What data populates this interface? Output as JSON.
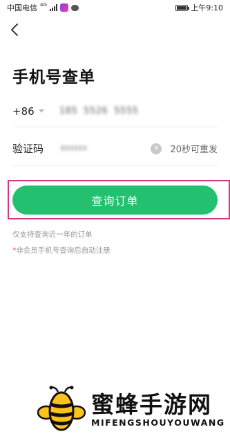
{
  "status_bar": {
    "carrier": "中国电信",
    "network": "4G",
    "time": "上午9:10",
    "battery_level": 0.85
  },
  "header": {
    "back_icon": "chevron-left-icon",
    "title": "手机号查单"
  },
  "phone_row": {
    "country_code": "+86",
    "phone_value": "185 5526 5555"
  },
  "code_row": {
    "label": "验证码",
    "code_value": "8XXXXX",
    "clear_icon": "clear-icon",
    "resend_label": "20秒可重发"
  },
  "actions": {
    "query_label": "查询订单",
    "button_color": "#22c06f",
    "highlight_color": "#d4377f"
  },
  "notes": {
    "note1": "仅支持查询近一年的订单",
    "note2_mark": "*",
    "note2": "非会员手机号查询后自动注册"
  },
  "watermark": {
    "title": "蜜蜂手游网",
    "subtitle": "MIFENGSHOUYOUWANG"
  }
}
